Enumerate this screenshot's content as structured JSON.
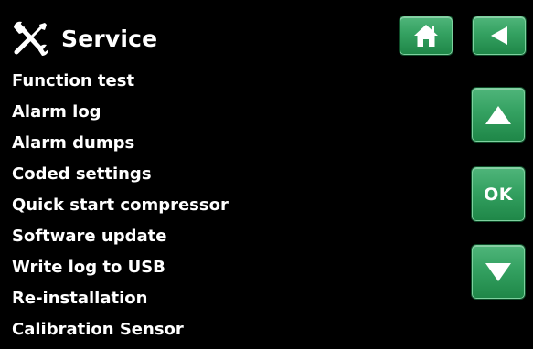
{
  "header": {
    "title": "Service",
    "title_icon": "tools-icon"
  },
  "menu": {
    "items": [
      {
        "label": "Function test"
      },
      {
        "label": "Alarm log"
      },
      {
        "label": "Alarm dumps"
      },
      {
        "label": "Coded settings"
      },
      {
        "label": "Quick start compressor"
      },
      {
        "label": "Software update"
      },
      {
        "label": "Write log to USB"
      },
      {
        "label": "Re-installation"
      },
      {
        "label": "Calibration Sensor"
      }
    ]
  },
  "buttons": {
    "home_icon": "home-icon",
    "back_icon": "back-arrow-icon",
    "up_icon": "up-arrow-icon",
    "ok_label": "OK",
    "down_icon": "down-arrow-icon"
  },
  "colors": {
    "background": "#000000",
    "text": "#ffffff",
    "button_green": "#34a161"
  }
}
